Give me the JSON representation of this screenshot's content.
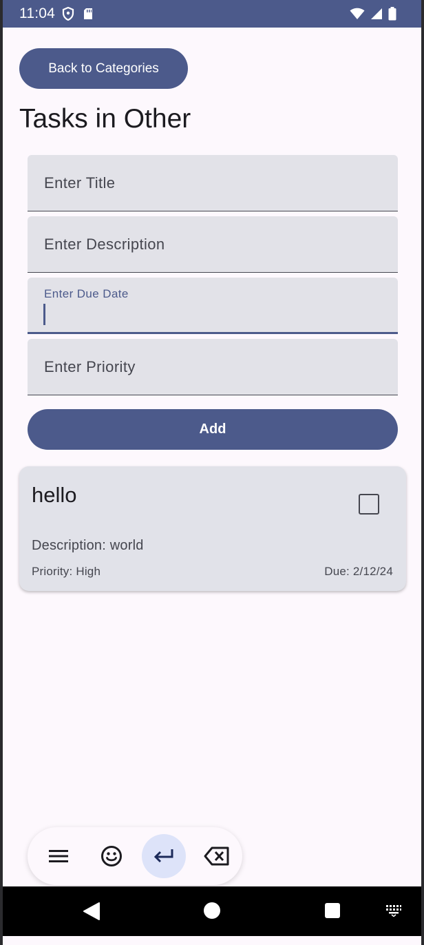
{
  "status_bar": {
    "time": "11:04",
    "left_icons": [
      "shield-icon",
      "sd-card-icon"
    ],
    "right_icons": [
      "wifi-icon",
      "signal-icon",
      "battery-icon"
    ],
    "background": "#4c5a8b"
  },
  "header": {
    "back_label": "Back to Categories",
    "title": "Tasks in Other"
  },
  "form": {
    "title_placeholder": "Enter Title",
    "description_placeholder": "Enter Description",
    "due_date_label": "Enter Due Date",
    "due_date_value": "",
    "priority_placeholder": "Enter Priority",
    "add_label": "Add"
  },
  "tasks": [
    {
      "title": "hello",
      "description": "Description: world",
      "priority": "Priority: High",
      "due": "Due: 2/12/24",
      "checked": false
    }
  ],
  "keyboard_toolbar": {
    "buttons": [
      "menu-icon",
      "emoji-icon",
      "enter-icon",
      "backspace-icon"
    ],
    "active_button": "enter-icon"
  },
  "nav_bar": {
    "buttons": [
      "back-icon",
      "home-icon",
      "recents-icon",
      "keyboard-switch-icon"
    ]
  },
  "colors": {
    "primary": "#4c5a8b",
    "surface": "#fdf8fd",
    "field_bg": "#e2e2e8",
    "card_bg": "#e1e2e9"
  }
}
